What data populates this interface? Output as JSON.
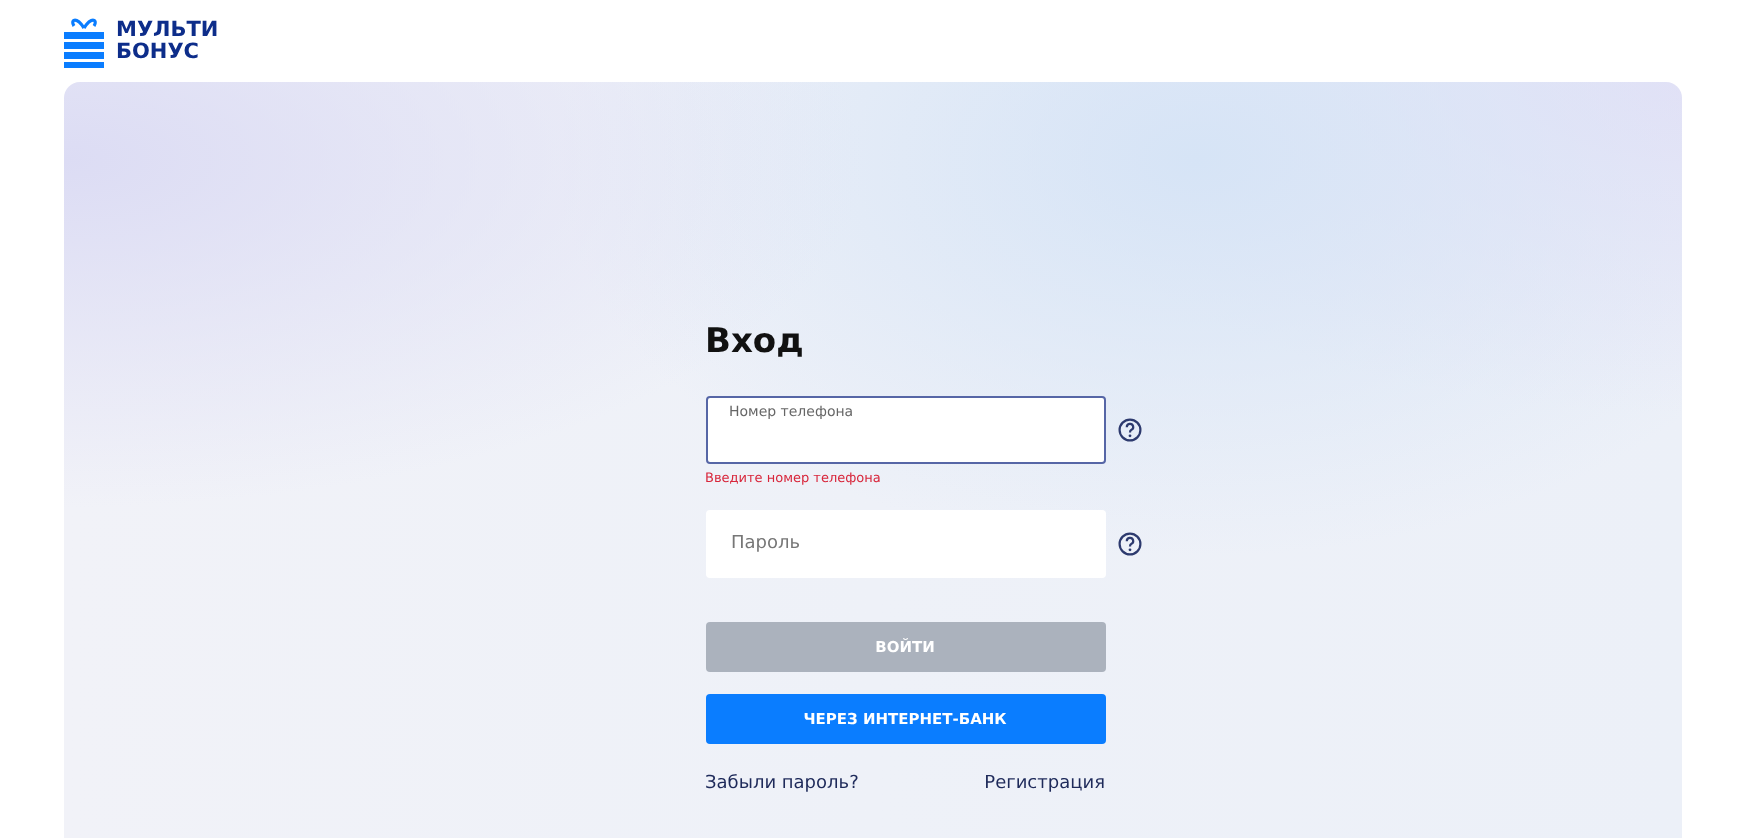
{
  "logo": {
    "lines": [
      "МУЛЬТИ",
      "БОНУС"
    ]
  },
  "form": {
    "title": "Вход",
    "fields": [
      {
        "label": "Номер телефона",
        "focused": true,
        "error": "Введите номер телефона"
      },
      {
        "placeholder": "Пароль",
        "focused": false
      }
    ],
    "buttons": [
      {
        "label": "ВОЙТИ",
        "disabled": true
      },
      {
        "label": "ЧЕРЕЗ ИНТЕРНЕТ-БАНК",
        "disabled": false
      }
    ],
    "links": [
      "Забыли пароль?",
      "Регистрация"
    ]
  }
}
